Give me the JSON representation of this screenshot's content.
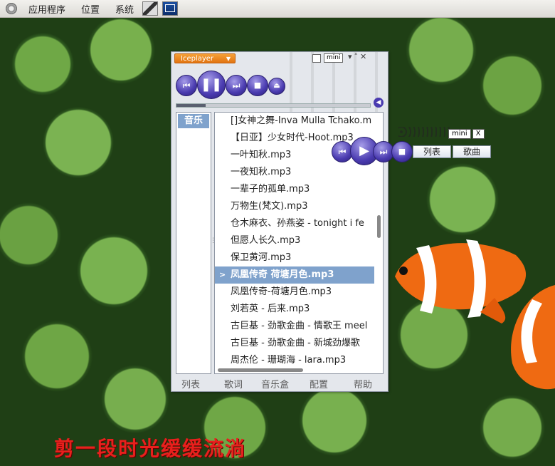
{
  "topbar": {
    "menus": [
      "应用程序",
      "位置",
      "系统"
    ]
  },
  "player": {
    "title": "Iceplayer",
    "mini_label": "mini",
    "window_icons": "✕",
    "progress": 0.15,
    "sidebar_tab": "音乐",
    "playlist": [
      "[]女神之舞-Inva Mulla Tchako.m",
      "【日亚】少女时代-Hoot.mp3",
      "一叶知秋.mp3",
      "一夜知秋.mp3",
      "一辈子的孤单.mp3",
      "万物生(梵文).mp3",
      "仓木麻衣、孙燕姿 - tonight i fe",
      "但愿人长久.mp3",
      "保卫黄河.mp3",
      "凤凰传奇   荷塘月色.mp3",
      "凤凰传奇-荷塘月色.mp3",
      "刘若英 - 后来.mp3",
      "古巨基 - 劲歌金曲 - 情歌王 meel",
      "古巨基 - 劲歌金曲 - 新城劲爆歌",
      "周杰伦 - 珊瑚海 - lara.mp3"
    ],
    "selected_index": 9,
    "selected_marker": ">",
    "bottom_nav": [
      "列表",
      "歌词",
      "音乐盒",
      "配置",
      "帮助"
    ]
  },
  "mini_player": {
    "mini_label": "mini",
    "close_label": "X",
    "list_button": "列表",
    "lyrics_button": "歌曲"
  },
  "caption": "剪一段时光缓缓流淌",
  "colors": {
    "accent_orange": "#e27412",
    "selection_blue": "#7fa2cc",
    "control_purple": "#4a3bb0",
    "caption_red": "#e8201d"
  }
}
